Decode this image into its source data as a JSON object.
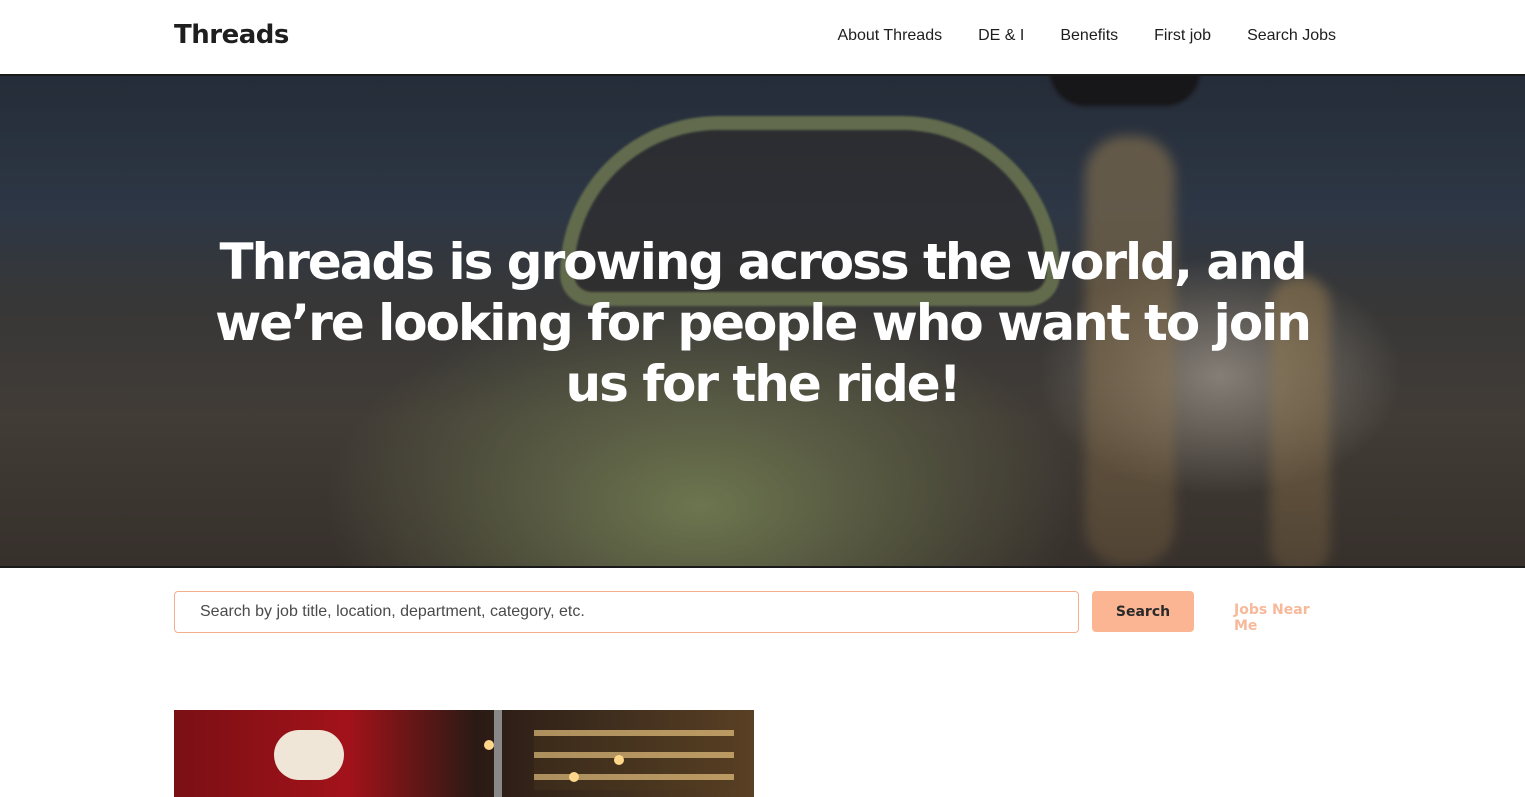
{
  "header": {
    "logo": "Threads",
    "nav": [
      "About Threads",
      "DE & I",
      "Benefits",
      "First job",
      "Search Jobs"
    ]
  },
  "hero": {
    "headline": "Threads is growing across the world, and we’re looking for people who want to join us for the ride!"
  },
  "search": {
    "placeholder": "Search by job title, location, department, category, etc.",
    "button_label": "Search",
    "near_me_label": "Jobs Near Me"
  },
  "colors": {
    "accent": "#fbb592",
    "accent_text": "#f7b99a",
    "input_border": "#f4b08c"
  }
}
